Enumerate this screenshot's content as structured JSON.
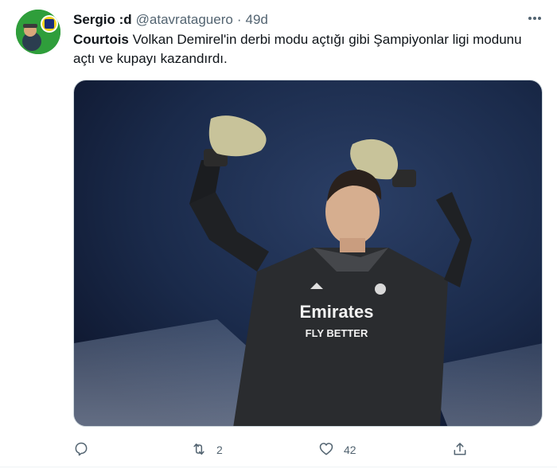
{
  "author": {
    "display_name": "Sergio :d",
    "handle": "@atavrataguero",
    "separator": "·",
    "time": "49d"
  },
  "tweet": {
    "mention": "Courtois",
    "text_line1": " Volkan Demirel'in derbi modu açtığı gibi Şampiyonlar ligi modunu",
    "text_line2": "açtı ve kupayı kazandırdı.",
    "media_jersey_line1": "Emirates",
    "media_jersey_line2": "FLY BETTER"
  },
  "actions": {
    "reply": {
      "icon": "reply-icon",
      "count": ""
    },
    "retweet": {
      "icon": "retweet-icon",
      "count": "2"
    },
    "like": {
      "icon": "heart-icon",
      "count": "42"
    },
    "share": {
      "icon": "share-icon",
      "count": ""
    }
  },
  "colors": {
    "secondary_text": "#536471",
    "avatar_bg": "#2e9b3a",
    "media_bg": "#17233f"
  }
}
